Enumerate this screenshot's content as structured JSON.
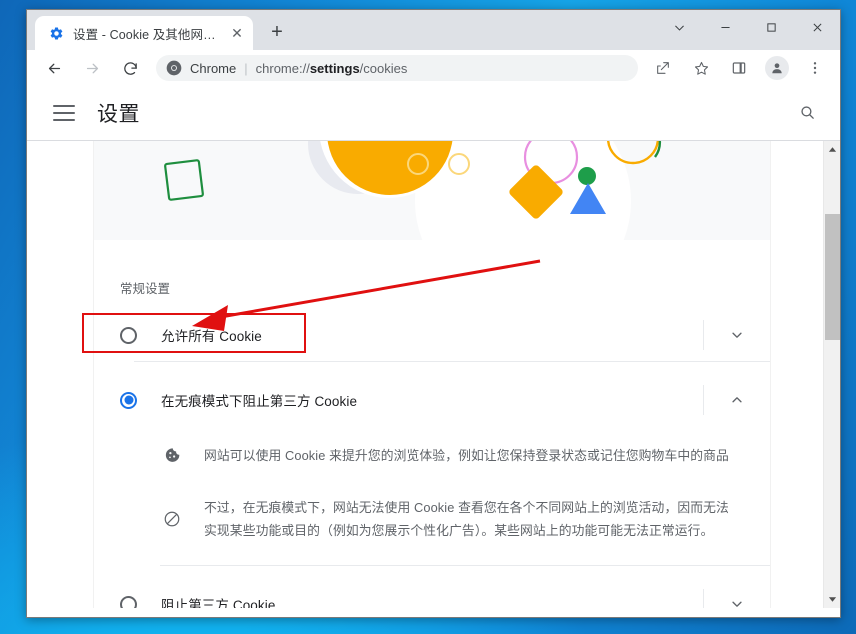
{
  "window": {
    "controls": [
      {
        "name": "tab-search-button",
        "glyph": "⌄"
      },
      {
        "name": "minimize-button",
        "glyph": "—"
      },
      {
        "name": "maximize-button",
        "glyph": "▢"
      },
      {
        "name": "close-button",
        "glyph": "✕"
      }
    ]
  },
  "tab": {
    "title": "设置 - Cookie 及其他网站数据",
    "favicon": "settings-gear-icon",
    "close_glyph": "✕",
    "newtab_glyph": "+"
  },
  "toolbar": {
    "back_glyph": "←",
    "forward_glyph": "→",
    "reload_glyph": "⟳",
    "omnibox": {
      "icon": "chrome-logo-icon",
      "scheme_label": "Chrome",
      "separator": "|",
      "url_prefix": "chrome://",
      "url_bold": "settings",
      "url_suffix": "/cookies"
    },
    "share_glyph": "⤴",
    "bookmark_glyph": "☆",
    "sidepanel_glyph": "▯",
    "profile_glyph": "person-icon",
    "menu_glyph": "⋮"
  },
  "settings_header": {
    "menu_icon": "hamburger-menu-icon",
    "title": "设置",
    "search_icon": "search-icon"
  },
  "content": {
    "section_label": "常规设置",
    "options": [
      {
        "id": "allow-all-cookies",
        "label": "允许所有 Cookie",
        "checked": false,
        "chevron": "chevron-down-icon",
        "chevron_glyph": "⌄"
      },
      {
        "id": "block-third-party-incognito",
        "label": "在无痕模式下阻止第三方 Cookie",
        "checked": true,
        "chevron": "chevron-up-icon",
        "chevron_glyph": "⌃"
      },
      {
        "id": "block-third-party-cookies",
        "label": "阻止第三方 Cookie",
        "checked": false,
        "chevron": "chevron-down-icon",
        "chevron_glyph": "⌄"
      }
    ],
    "descriptions": [
      {
        "icon": "cookie-icon",
        "text": "网站可以使用 Cookie 来提升您的浏览体验，例如让您保持登录状态或记住您购物车中的商品"
      },
      {
        "icon": "block-circle-slash-icon",
        "text": "不过，在无痕模式下，网站无法使用 Cookie 查看您在各个不同网站上的浏览活动，因而无法实现某些功能或目的（例如为您展示个性化广告）。某些网站上的功能可能无法正常运行。"
      }
    ]
  },
  "scrollbar": {
    "up_glyph": "▲",
    "down_glyph": "▼"
  },
  "colors": {
    "accent": "#1a73e8",
    "annotation": "#e01010",
    "banner_bg": "#f8f9fa",
    "text_primary": "#202124",
    "text_secondary": "#5f6368"
  }
}
